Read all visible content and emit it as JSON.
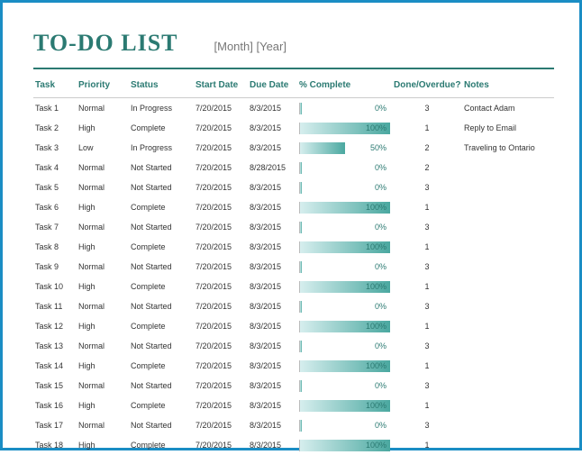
{
  "header": {
    "title": "TO-DO LIST",
    "subtitle": "[Month]  [Year]"
  },
  "columns": {
    "task": "Task",
    "priority": "Priority",
    "status": "Status",
    "start": "Start Date",
    "due": "Due Date",
    "pct": "% Complete",
    "done": "Done/Overdue?",
    "notes": "Notes"
  },
  "chart_data": {
    "type": "table",
    "title": "TO-DO LIST",
    "columns": [
      "Task",
      "Priority",
      "Status",
      "Start Date",
      "Due Date",
      "% Complete",
      "Done/Overdue?",
      "Notes"
    ],
    "rows": [
      {
        "task": "Task 1",
        "priority": "Normal",
        "status": "In Progress",
        "start": "7/20/2015",
        "due": "8/3/2015",
        "pct": 0,
        "done": "3",
        "notes": "Contact Adam"
      },
      {
        "task": "Task 2",
        "priority": "High",
        "status": "Complete",
        "start": "7/20/2015",
        "due": "8/3/2015",
        "pct": 100,
        "done": "1",
        "notes": "Reply to Email"
      },
      {
        "task": "Task 3",
        "priority": "Low",
        "status": "In Progress",
        "start": "7/20/2015",
        "due": "8/3/2015",
        "pct": 50,
        "done": "2",
        "notes": "Traveling to Ontario"
      },
      {
        "task": "Task 4",
        "priority": "Normal",
        "status": "Not Started",
        "start": "7/20/2015",
        "due": "8/28/2015",
        "pct": 0,
        "done": "2",
        "notes": ""
      },
      {
        "task": "Task 5",
        "priority": "Normal",
        "status": "Not Started",
        "start": "7/20/2015",
        "due": "8/3/2015",
        "pct": 0,
        "done": "3",
        "notes": ""
      },
      {
        "task": "Task 6",
        "priority": "High",
        "status": "Complete",
        "start": "7/20/2015",
        "due": "8/3/2015",
        "pct": 100,
        "done": "1",
        "notes": ""
      },
      {
        "task": "Task 7",
        "priority": "Normal",
        "status": "Not Started",
        "start": "7/20/2015",
        "due": "8/3/2015",
        "pct": 0,
        "done": "3",
        "notes": ""
      },
      {
        "task": "Task 8",
        "priority": "High",
        "status": "Complete",
        "start": "7/20/2015",
        "due": "8/3/2015",
        "pct": 100,
        "done": "1",
        "notes": ""
      },
      {
        "task": "Task 9",
        "priority": "Normal",
        "status": "Not Started",
        "start": "7/20/2015",
        "due": "8/3/2015",
        "pct": 0,
        "done": "3",
        "notes": ""
      },
      {
        "task": "Task 10",
        "priority": "High",
        "status": "Complete",
        "start": "7/20/2015",
        "due": "8/3/2015",
        "pct": 100,
        "done": "1",
        "notes": ""
      },
      {
        "task": "Task 11",
        "priority": "Normal",
        "status": "Not Started",
        "start": "7/20/2015",
        "due": "8/3/2015",
        "pct": 0,
        "done": "3",
        "notes": ""
      },
      {
        "task": "Task 12",
        "priority": "High",
        "status": "Complete",
        "start": "7/20/2015",
        "due": "8/3/2015",
        "pct": 100,
        "done": "1",
        "notes": ""
      },
      {
        "task": "Task 13",
        "priority": "Normal",
        "status": "Not Started",
        "start": "7/20/2015",
        "due": "8/3/2015",
        "pct": 0,
        "done": "3",
        "notes": ""
      },
      {
        "task": "Task 14",
        "priority": "High",
        "status": "Complete",
        "start": "7/20/2015",
        "due": "8/3/2015",
        "pct": 100,
        "done": "1",
        "notes": ""
      },
      {
        "task": "Task 15",
        "priority": "Normal",
        "status": "Not Started",
        "start": "7/20/2015",
        "due": "8/3/2015",
        "pct": 0,
        "done": "3",
        "notes": ""
      },
      {
        "task": "Task 16",
        "priority": "High",
        "status": "Complete",
        "start": "7/20/2015",
        "due": "8/3/2015",
        "pct": 100,
        "done": "1",
        "notes": ""
      },
      {
        "task": "Task 17",
        "priority": "Normal",
        "status": "Not Started",
        "start": "7/20/2015",
        "due": "8/3/2015",
        "pct": 0,
        "done": "3",
        "notes": ""
      },
      {
        "task": "Task 18",
        "priority": "High",
        "status": "Complete",
        "start": "7/20/2015",
        "due": "8/3/2015",
        "pct": 100,
        "done": "1",
        "notes": ""
      }
    ]
  }
}
